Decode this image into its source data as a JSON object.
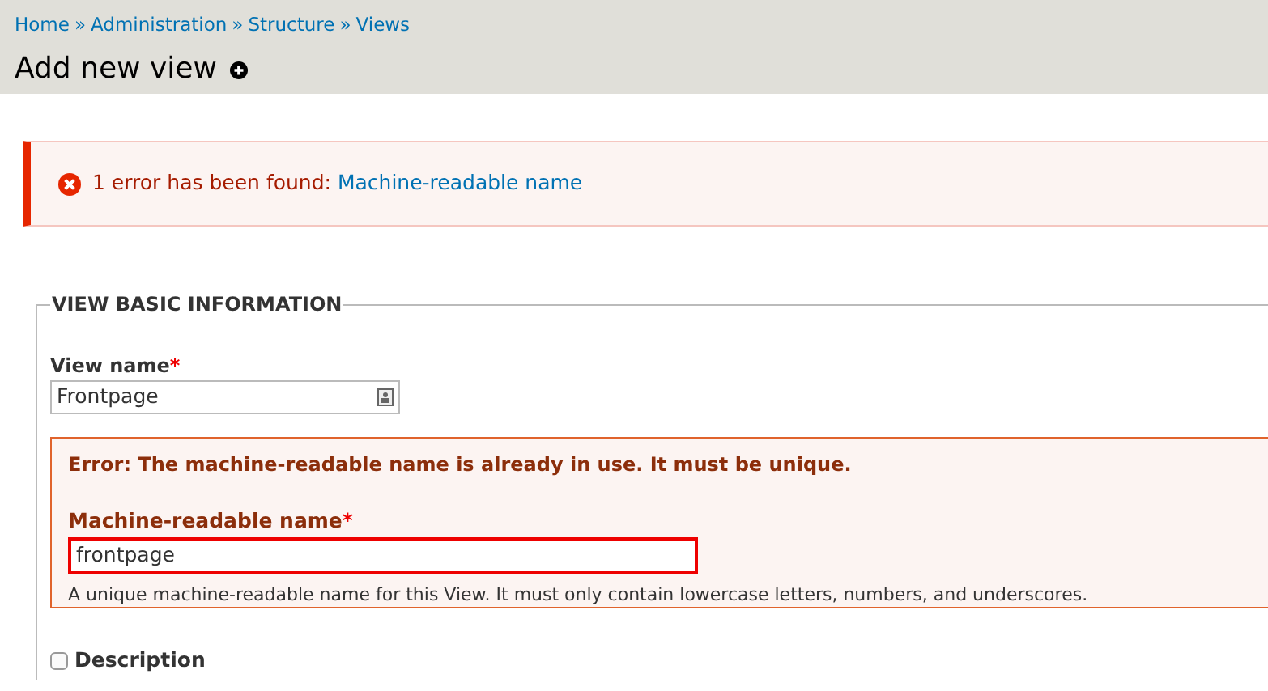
{
  "breadcrumb": {
    "separator": "»",
    "items": [
      "Home",
      "Administration",
      "Structure",
      "Views"
    ]
  },
  "page_title": "Add new view",
  "messages": [
    {
      "kind": "error",
      "text": "1 error has been found: ",
      "link": "Machine-readable name"
    }
  ],
  "fieldset": {
    "legend": "VIEW BASIC INFORMATION",
    "fields": [
      {
        "kind": "text",
        "label": "View name",
        "required_mark": "*",
        "value": "Frontpage",
        "error": false
      },
      {
        "kind": "error-group",
        "error_text": "Error: The machine-readable name is already in use. It must be unique.",
        "label": "Machine-readable name",
        "required_mark": "*",
        "value": "frontpage",
        "error": true,
        "description": "A unique machine-readable name for this View. It must only contain lowercase letters, numbers, and underscores."
      },
      {
        "kind": "checkbox",
        "label": "Description",
        "checked": false
      }
    ]
  }
}
